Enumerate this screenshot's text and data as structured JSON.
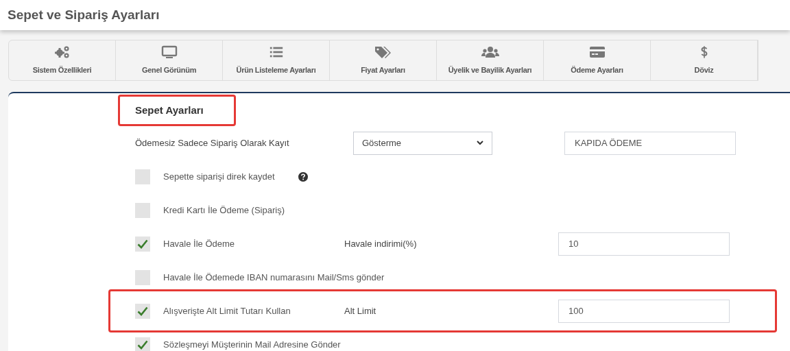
{
  "page_title": "Sepet ve Sipariş Ayarları",
  "tabs": [
    {
      "label": "Sistem Özellikleri",
      "kind": "gears",
      "selected": false
    },
    {
      "label": "Genel Görünüm",
      "kind": "monitor",
      "selected": false
    },
    {
      "label": "Ürün Listeleme Ayarları",
      "kind": "list",
      "selected": false
    },
    {
      "label": "Fiyat Ayarları",
      "kind": "tags",
      "selected": false
    },
    {
      "label": "Üyelik ve Bayilik Ayarları",
      "kind": "users",
      "selected": false
    },
    {
      "label": "Ödeme Ayarları",
      "kind": "card",
      "selected": false
    },
    {
      "label": "Döviz",
      "kind": "dollar",
      "selected": false
    }
  ],
  "section": {
    "heading": "Sepet Ayarları",
    "highlighted": true,
    "rows": [
      {
        "kind": "select",
        "label": "Ödemesiz Sadece Sipariş Olarak Kayıt",
        "select_value": "Gösterme",
        "field_value": "KAPIDA ÖDEME",
        "highlighted": false
      },
      {
        "kind": "checkbox",
        "label": "Sepette siparişi direk kaydet",
        "checked": false,
        "help": true,
        "highlighted": false
      },
      {
        "kind": "checkbox",
        "label": "Kredi Kartı İle Ödeme (Sipariş)",
        "checked": false,
        "highlighted": false
      },
      {
        "kind": "checkbox",
        "label": "Havale İle Ödeme",
        "checked": true,
        "field_label": "Havale indirimi(%)",
        "field_value": "10",
        "highlighted": false
      },
      {
        "kind": "checkbox",
        "label": "Havale İle Ödemede IBAN numarasını Mail/Sms gönder",
        "checked": false,
        "highlighted": false
      },
      {
        "kind": "checkbox",
        "label": "Alışverişte Alt Limit Tutarı Kullan",
        "checked": true,
        "field_label": "Alt Limit",
        "field_value": "100",
        "highlighted": true
      },
      {
        "kind": "checkbox",
        "label": "Sözleşmeyi Müşterinin Mail Adresine Gönder",
        "checked": true,
        "highlighted": false
      }
    ]
  }
}
